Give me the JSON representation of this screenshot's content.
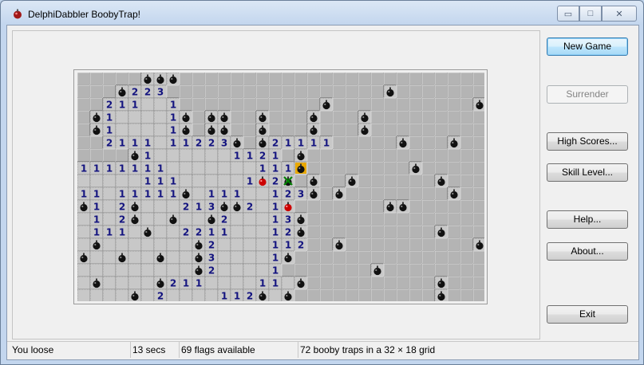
{
  "window": {
    "title": "DelphiDabbler BoobyTrap!",
    "min_glyph": "▭",
    "max_glyph": "□",
    "close_glyph": "✕"
  },
  "buttons": {
    "new_game": "New Game",
    "surrender": "Surrender",
    "high_scores": "High Scores...",
    "skill_level": "Skill Level...",
    "help": "Help...",
    "about": "About...",
    "exit": "Exit"
  },
  "status": {
    "result": "You loose",
    "time": "13 secs",
    "flags": "69 flags available",
    "traps": "72 booby traps in a 32 × 18 grid"
  },
  "colors": {
    "number": "#13137f",
    "revealed": "#c8c8c8",
    "hidden": "#b4b4b4",
    "hit": "#cc0000",
    "flag": "#e8a800",
    "wrong": "#008000"
  },
  "grid": {
    "cols": 32,
    "rows": 18,
    "legend": {
      "#": "hidden",
      ".": "revealed-empty",
      "B": "booby-trap",
      "R": "triggered-trap",
      "F": "flag",
      "X": "wrong-flag",
      "1-8": "number"
    },
    "cells": [
      "#####BBB########################",
      "###B223#################B#######",
      "##211..1###########B###########B",
      "#B1....1B#BB##B###B###B#########",
      "#B1....1B#BB##B###B###B#########",
      "##2111.11223B#B21111#####B###B##",
      "####B1......1121#B##############",
      "1111111.......111F########B#####",
      ".....111.....1R2X#B##B######B###",
      "11.11111B.111..123B#B########B##",
      "B1.2B...213BB2.1R#######BB######",
      ".1.2B..B..B2...13B##############",
      ".111.B..2211...12B##########B###",
      ".B.......B2....112##B##########B",
      "B..B..B..B3....1B###############",
      ".........B2....1#######B########",
      ".B....B211....11.B##########B###",
      "....B.2....112B.B###########B###"
    ]
  }
}
